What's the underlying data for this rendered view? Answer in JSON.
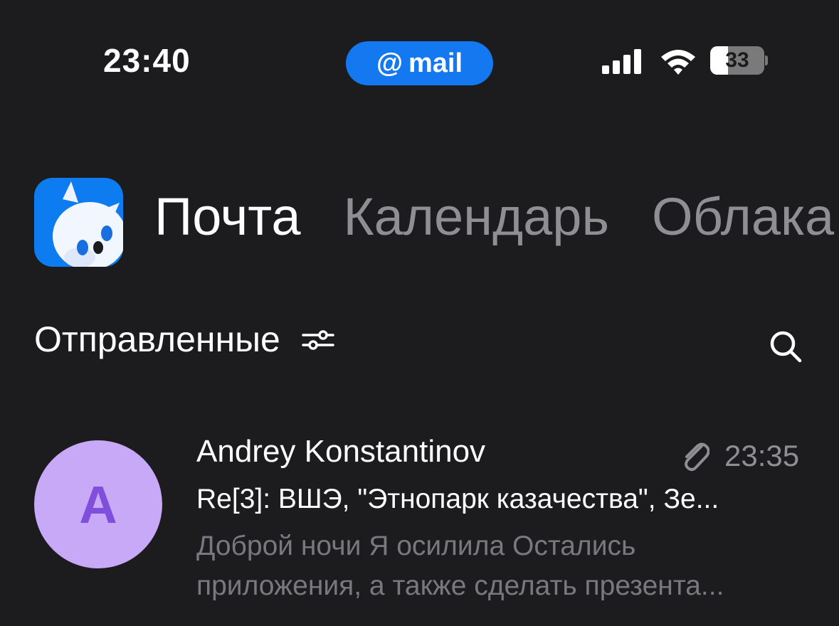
{
  "status_bar": {
    "time": "23:40",
    "pill": {
      "at_symbol": "@",
      "label": "mail",
      "color": "#1478f0"
    },
    "signal_icon": "cellular-signal-icon",
    "wifi_icon": "wifi-icon",
    "battery": {
      "label": "33",
      "level_percent": 33
    }
  },
  "header": {
    "logo_icon": "mail-ru-mascot-logo",
    "tabs": [
      {
        "label": "Почта",
        "active": true
      },
      {
        "label": "Календарь",
        "active": false
      },
      {
        "label": "Облака",
        "active": false
      }
    ]
  },
  "folder": {
    "title": "Отправленные",
    "filter_icon": "sliders-filter-icon",
    "search_icon": "search-icon"
  },
  "messages": [
    {
      "avatar_letter": "A",
      "avatar_color": "#c8a9f7",
      "sender": "Andrey Konstantinov",
      "has_attachment": true,
      "attachment_icon": "paperclip-icon",
      "time": "23:35",
      "subject": "Re[3]: ВШЭ, \"Этнопарк казачества\", Зе...",
      "preview_line1": "Доброй ночи Я осилила Остались",
      "preview_line2": "приложения, а также сделать презента..."
    }
  ]
}
